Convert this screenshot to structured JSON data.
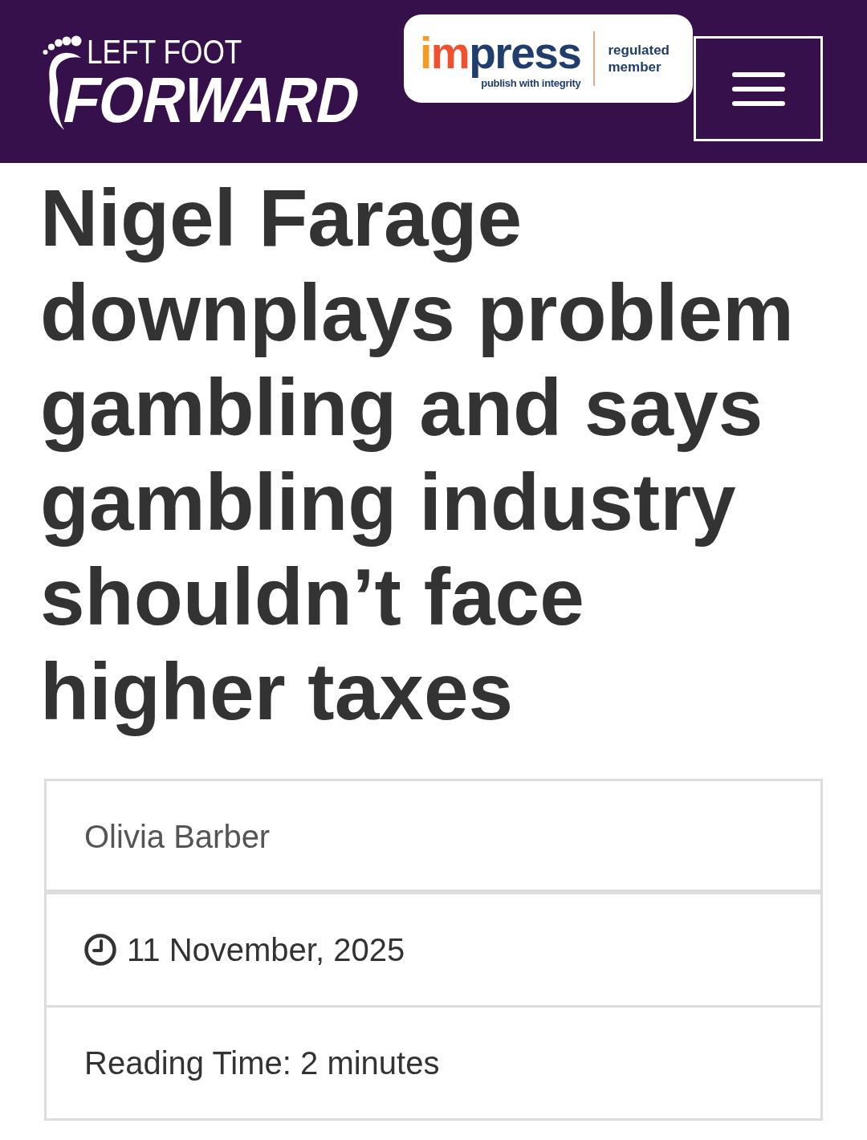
{
  "header": {
    "logo": {
      "line_1": "LEFT FOOT",
      "line_2": "FORWARD"
    },
    "press_badge": {
      "wordmark": "impress",
      "tagline": "publish with integrity",
      "label": "regulated member"
    }
  },
  "article": {
    "title": "Nigel Farage downplays problem gambling and says gambling industry shouldn’t face higher taxes",
    "meta": [
      {
        "kind": "author",
        "text": "Olivia Barber"
      },
      {
        "kind": "date",
        "text": "11 November, 2025"
      },
      {
        "kind": "reading_time",
        "text": "Reading Time: 2 minutes"
      }
    ]
  }
}
